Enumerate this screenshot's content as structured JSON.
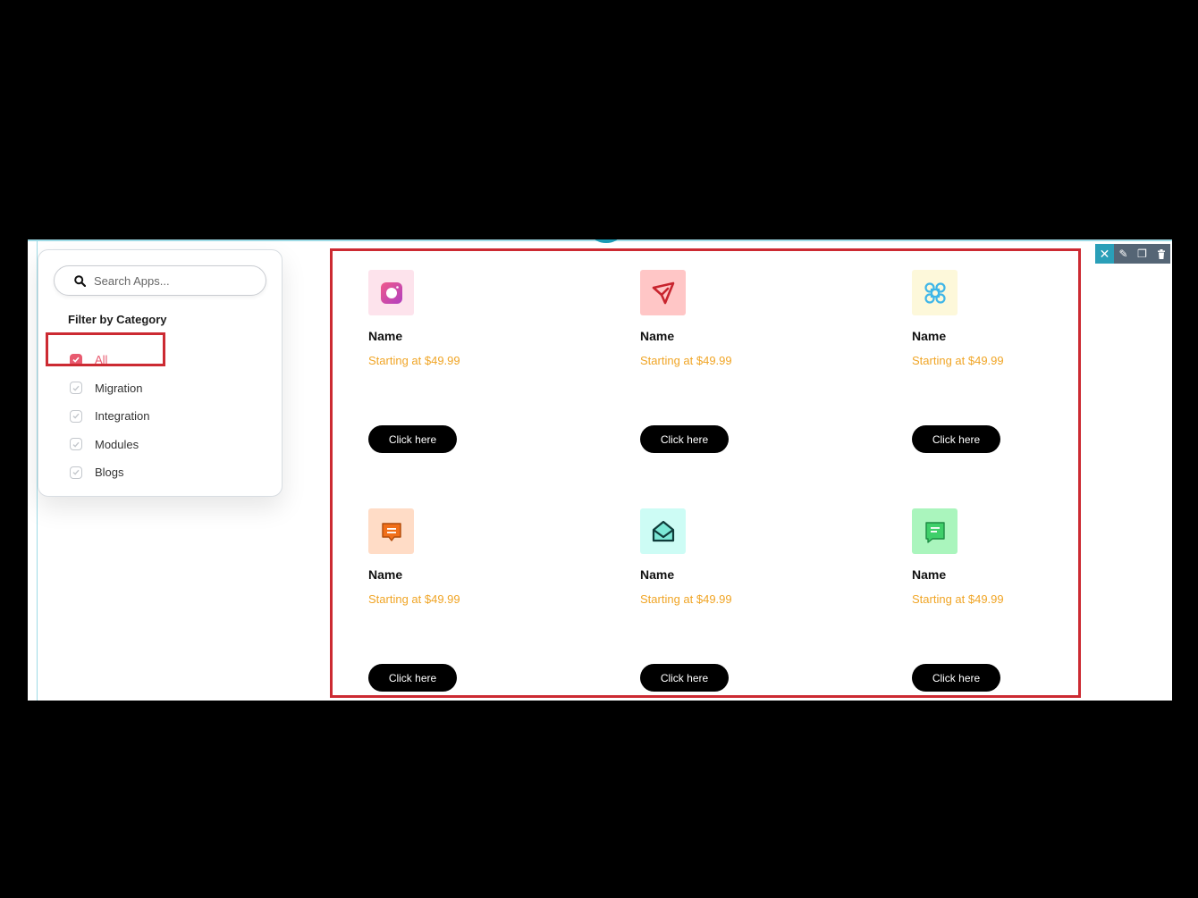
{
  "editor": {
    "toolbar": [
      {
        "name": "close-icon",
        "glyph": "✕"
      },
      {
        "name": "edit-icon",
        "glyph": "✎"
      },
      {
        "name": "duplicate-icon",
        "glyph": "❐"
      },
      {
        "name": "trash-icon",
        "glyph": "🗑"
      }
    ]
  },
  "sidebar": {
    "search": {
      "placeholder": "Search Apps...",
      "value": ""
    },
    "filter_title": "Filter by Category",
    "categories": [
      {
        "label": "All",
        "checked": true
      },
      {
        "label": "Migration",
        "checked": false
      },
      {
        "label": "Integration",
        "checked": false
      },
      {
        "label": "Modules",
        "checked": false
      },
      {
        "label": "Blogs",
        "checked": false
      }
    ]
  },
  "apps": [
    {
      "name": "Name",
      "price": "Starting at $49.99",
      "button": "Click here",
      "icon": "camera-icon",
      "icon_bg": "#fde3ec"
    },
    {
      "name": "Name",
      "price": "Starting at $49.99",
      "button": "Click here",
      "icon": "paper-plane-icon",
      "icon_bg": "#ffc6c6"
    },
    {
      "name": "Name",
      "price": "Starting at $49.99",
      "button": "Click here",
      "icon": "command-icon",
      "icon_bg": "#fdf8da"
    },
    {
      "name": "Name",
      "price": "Starting at $49.99",
      "button": "Click here",
      "icon": "chat-bubble-icon",
      "icon_bg": "#ffdcc6"
    },
    {
      "name": "Name",
      "price": "Starting at $49.99",
      "button": "Click here",
      "icon": "envelope-icon",
      "icon_bg": "#cdfcf5"
    },
    {
      "name": "Name",
      "price": "Starting at $49.99",
      "button": "Click here",
      "icon": "message-icon",
      "icon_bg": "#aaf5bd"
    }
  ],
  "colors": {
    "accent": "#e85a6f",
    "price": "#f0a526",
    "highlight": "#cc2a32"
  }
}
